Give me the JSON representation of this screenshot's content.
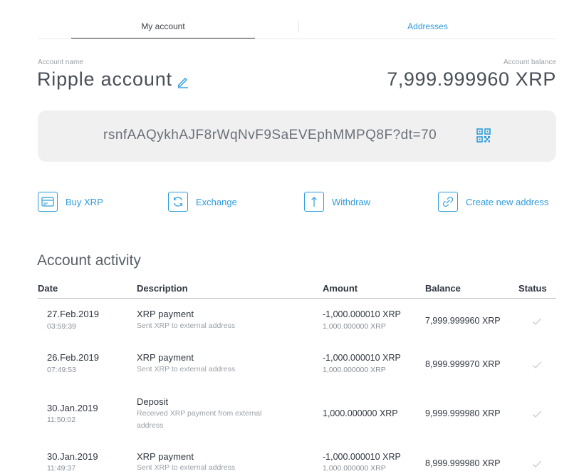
{
  "tabs": [
    {
      "label": "My account",
      "active": true
    },
    {
      "label": "Addresses",
      "active": false
    }
  ],
  "account": {
    "name_label": "Account name",
    "name": "Ripple account",
    "balance_label": "Account balance",
    "balance": "7,999.999960 XRP",
    "address": "rsnfAAQykhAJF8rWqNvF9SaEVEphMMPQ8F?dt=70"
  },
  "actions": [
    {
      "label": "Buy XRP",
      "icon": "card-icon"
    },
    {
      "label": "Exchange",
      "icon": "refresh-icon"
    },
    {
      "label": "Withdraw",
      "icon": "arrow-up-icon"
    },
    {
      "label": "Create new address",
      "icon": "link-icon"
    }
  ],
  "activity": {
    "title": "Account activity",
    "columns": [
      "Date",
      "Description",
      "Amount",
      "Balance",
      "Status"
    ],
    "rows": [
      {
        "date": "27.Feb.2019",
        "time": "03:59:39",
        "title": "XRP payment",
        "subtitle": "Sent XRP to external address",
        "amount": "-1,000.000010 XRP",
        "amount_sub": "1,000.000000 XRP",
        "balance": "7,999.999960 XRP"
      },
      {
        "date": "26.Feb.2019",
        "time": "07:49:53",
        "title": "XRP payment",
        "subtitle": "Sent XRP to external address",
        "amount": "-1,000.000010 XRP",
        "amount_sub": "1,000.000000 XRP",
        "balance": "8,999.999970 XRP"
      },
      {
        "date": "30.Jan.2019",
        "time": "11:50:02",
        "title": "Deposit",
        "subtitle": "Received XRP payment from external address",
        "amount": "1,000.000000 XRP",
        "amount_sub": "",
        "balance": "9,999.999980 XRP"
      },
      {
        "date": "30.Jan.2019",
        "time": "11:49:37",
        "title": "XRP payment",
        "subtitle": "Sent XRP to external address",
        "amount": "-1,000.000010 XRP",
        "amount_sub": "1,000.000000 XRP",
        "balance": "8,999.999980 XRP"
      }
    ]
  },
  "colors": {
    "accent": "#2d9cdb",
    "status_check": "#c8ccd0"
  }
}
